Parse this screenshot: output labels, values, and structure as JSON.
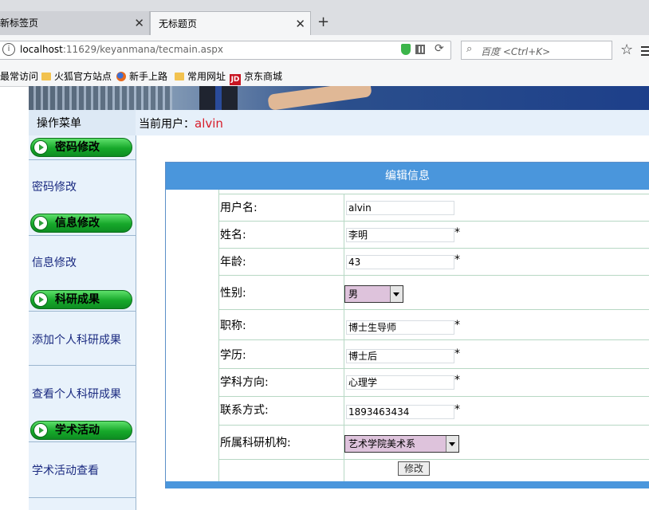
{
  "browser": {
    "tabs": [
      {
        "label": "新标签页"
      },
      {
        "label": "无标题页"
      }
    ],
    "url": {
      "host": "localhost",
      "rest": ":11629/keyanmana/tecmain.aspx"
    },
    "search_placeholder": "百度 <Ctrl+K>",
    "bookmarks": [
      "最常访问",
      "火狐官方站点",
      "新手上路",
      "常用网址",
      "京东商城"
    ],
    "bookmark_icons": [
      "none",
      "folder-icon",
      "firefox-icon",
      "folder-icon",
      "jd-icon"
    ]
  },
  "sidebar": {
    "title": "操作菜单",
    "groups": [
      {
        "label": "密码修改",
        "items": [
          "密码修改"
        ]
      },
      {
        "label": "信息修改",
        "items": [
          "信息修改"
        ]
      },
      {
        "label": "科研成果",
        "items": [
          "添加个人科研成果",
          "查看个人科研成果"
        ]
      },
      {
        "label": "学术活动",
        "items": [
          "学术活动查看"
        ]
      }
    ]
  },
  "userbar": {
    "label": "当前用户：",
    "username": "alvin"
  },
  "form": {
    "title": "编辑信息",
    "fields": [
      {
        "label": "用户名:",
        "value": "alvin",
        "required": false
      },
      {
        "label": "姓名:",
        "value": "李明",
        "required": true
      },
      {
        "label": "年龄:",
        "value": "43",
        "required": true
      },
      {
        "label": "性别:",
        "value": "男",
        "required": false
      },
      {
        "label": "职称:",
        "value": "博士生导师",
        "required": true
      },
      {
        "label": "学历:",
        "value": "博士后",
        "required": true
      },
      {
        "label": "学科方向:",
        "value": "心理学",
        "required": true
      },
      {
        "label": "联系方式:",
        "value": "1893463434",
        "required": true
      },
      {
        "label": "所属科研机构:",
        "value": "艺术学院美术系",
        "required": false
      }
    ],
    "required_mark": "*",
    "submit_label": "修改"
  },
  "colors": {
    "accent_blue": "#4a96dc",
    "group_green": "#16a82a",
    "username_red": "#d71c2a",
    "select_bg": "#dec3dc"
  }
}
